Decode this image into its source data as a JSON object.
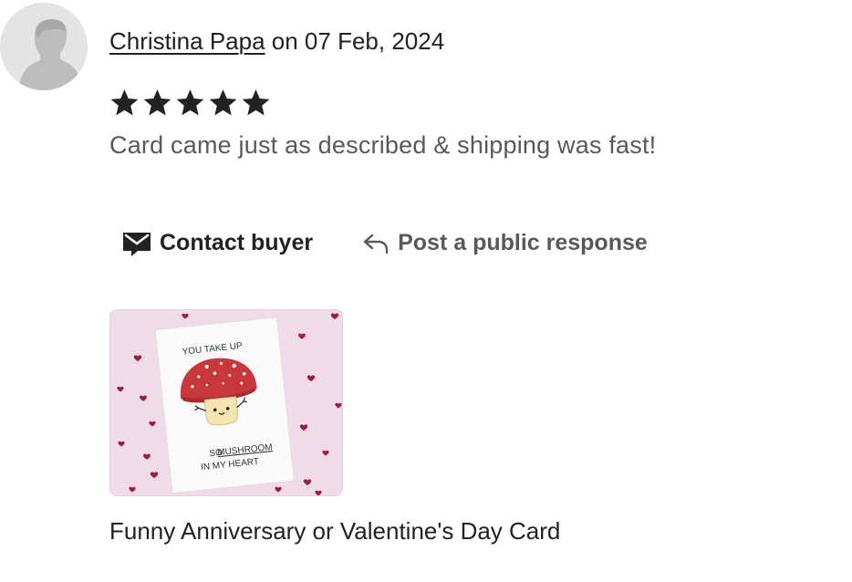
{
  "review": {
    "reviewer_name": "Christina Papa",
    "date_prefix": " on ",
    "date": "07 Feb, 2024",
    "rating": 5,
    "rating_max": 5,
    "text": "Card came just as described & shipping was fast!"
  },
  "actions": {
    "contact_buyer_label": "Contact buyer",
    "post_response_label": "Post a public response"
  },
  "listing": {
    "title": "Funny Anniversary or Valentine's Day Card",
    "card_text": {
      "line1": "YOU TAKE UP",
      "line2_prefix": "SO",
      "line2_word": "MUSHROOM",
      "line3": "IN MY HEART"
    }
  },
  "colors": {
    "text_primary": "#222222",
    "text_secondary": "#595959",
    "star": "#222222",
    "card_background": "#f0dbe8",
    "mushroom_cap": "#c8373a",
    "heart": "#9b1f3c"
  },
  "icons": {
    "avatar": "default-user-silhouette",
    "star": "star-icon",
    "contact": "envelope-icon",
    "reply": "reply-arrow-icon"
  }
}
